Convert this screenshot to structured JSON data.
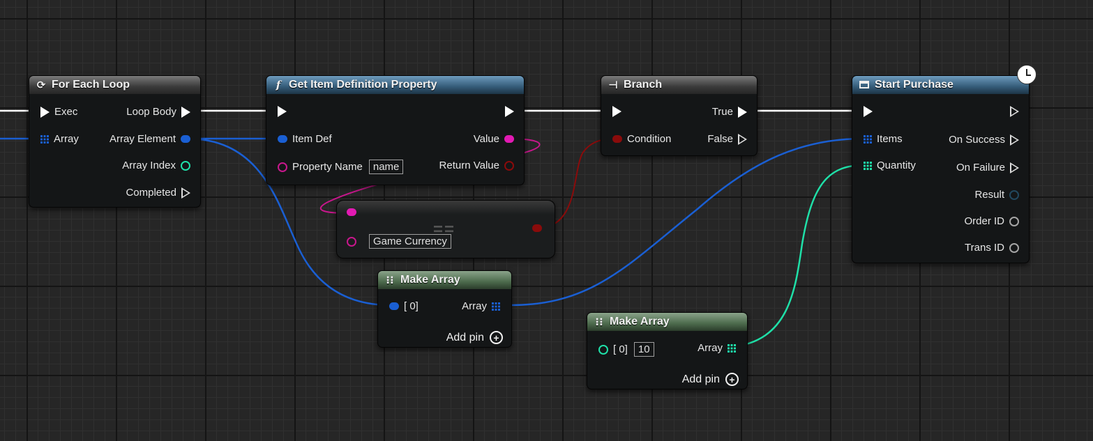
{
  "colors": {
    "object": "#1a5fd3",
    "integer": "#1fe0a8",
    "name": "#c8178c",
    "boolean": "#8a0b0b",
    "exec": "#ffffff"
  },
  "for_each_loop": {
    "title": "For Each Loop",
    "icon": "loop-icon",
    "inputs": {
      "exec": "Exec",
      "array": "Array"
    },
    "outputs": {
      "loop_body": "Loop Body",
      "array_element": "Array Element",
      "array_index": "Array Index",
      "completed": "Completed"
    }
  },
  "get_item_property": {
    "title": "Get Item Definition Property",
    "icon": "function-icon",
    "inputs": {
      "item_def": "Item Def",
      "property_name": "Property Name",
      "property_name_value": "name"
    },
    "outputs": {
      "value": "Value",
      "return_value": "Return Value"
    }
  },
  "equals_node": {
    "operator": "==",
    "input_value": "Game Currency"
  },
  "branch": {
    "title": "Branch",
    "icon": "branch-icon",
    "inputs": {
      "condition": "Condition"
    },
    "outputs": {
      "true": "True",
      "false": "False"
    }
  },
  "start_purchase": {
    "title": "Start Purchase",
    "icon": "window-icon",
    "inputs": {
      "items": "Items",
      "quantity": "Quantity"
    },
    "outputs": {
      "on_success": "On Success",
      "on_failure": "On Failure",
      "result": "Result",
      "order_id": "Order ID",
      "trans_id": "Trans ID"
    }
  },
  "make_array_1": {
    "title": "Make Array",
    "icon": "make-array-icon",
    "input_label": "[ 0]",
    "output_label": "Array",
    "add_pin": "Add pin"
  },
  "make_array_2": {
    "title": "Make Array",
    "icon": "make-array-icon",
    "input_label": "[ 0]",
    "input_value": "10",
    "output_label": "Array",
    "add_pin": "Add pin"
  }
}
